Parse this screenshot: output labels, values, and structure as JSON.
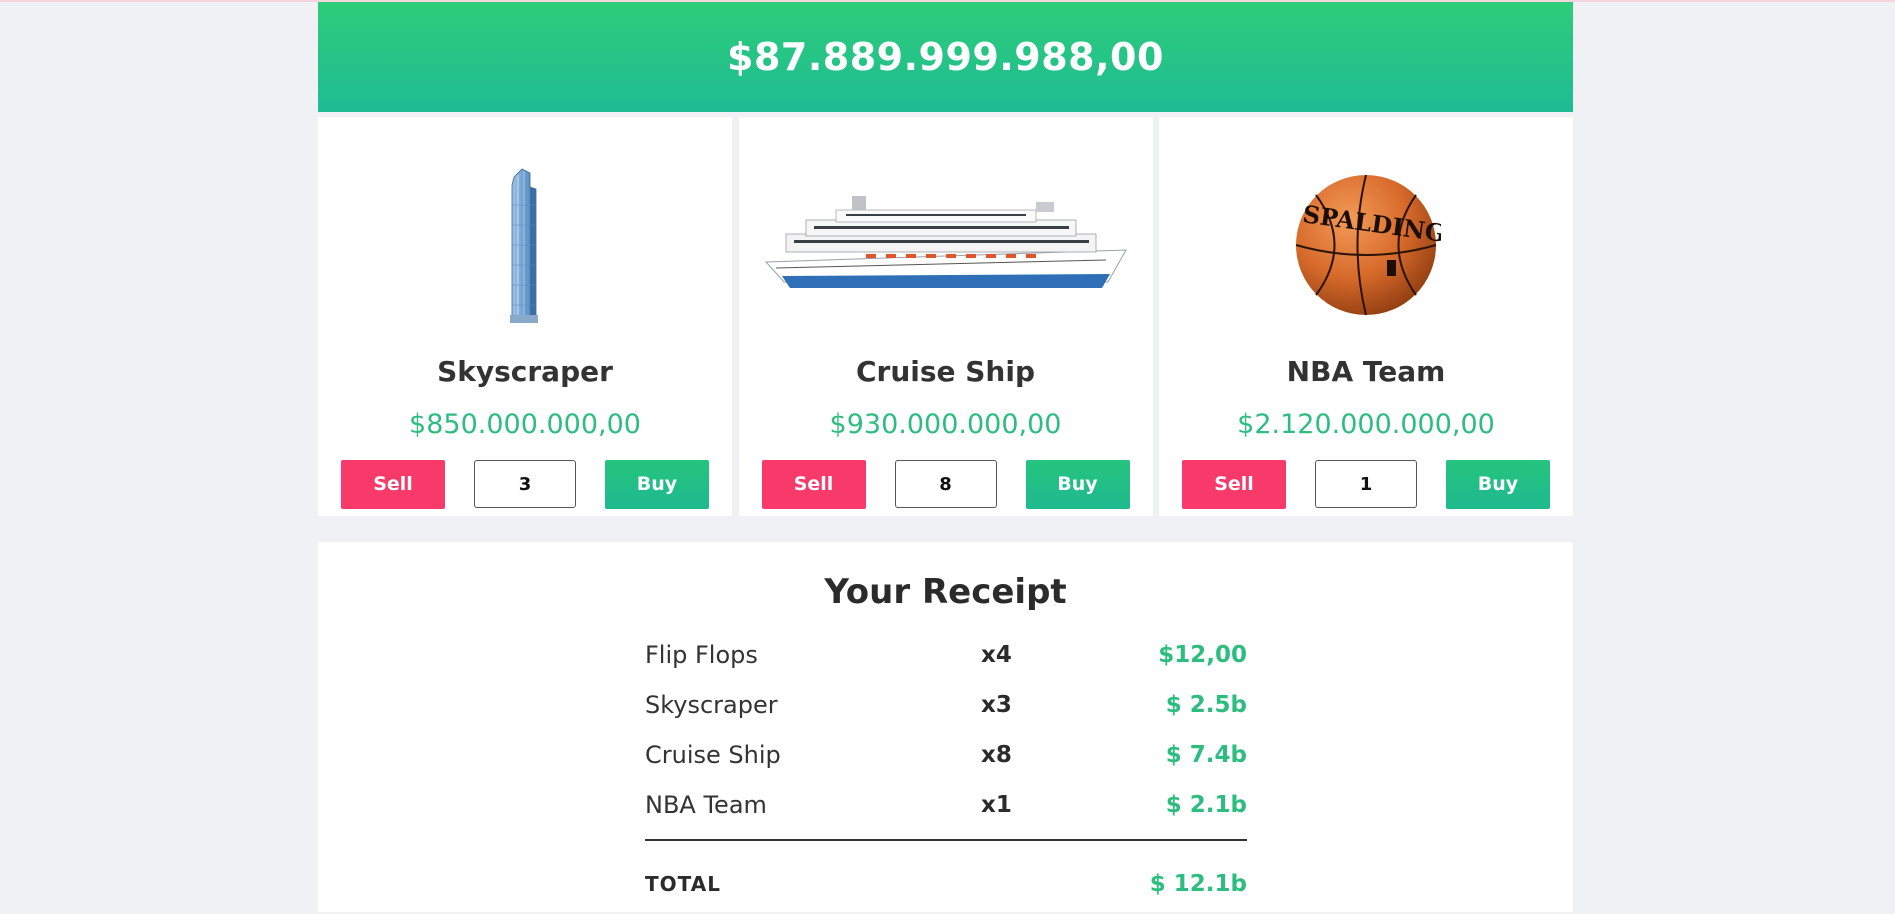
{
  "balance": "$87.889.999.988,00",
  "products": [
    {
      "name": "Skyscraper",
      "price": "$850.000.000,00",
      "quantity": "3",
      "sell_label": "Sell",
      "buy_label": "Buy",
      "icon": "skyscraper-image"
    },
    {
      "name": "Cruise Ship",
      "price": "$930.000.000,00",
      "quantity": "8",
      "sell_label": "Sell",
      "buy_label": "Buy",
      "icon": "cruise-ship-image"
    },
    {
      "name": "NBA Team",
      "price": "$2.120.000.000,00",
      "quantity": "1",
      "sell_label": "Sell",
      "buy_label": "Buy",
      "icon": "basketball-image",
      "ball_brand": "SPALDING"
    }
  ],
  "receipt": {
    "title": "Your Receipt",
    "items": [
      {
        "name": "Flip Flops",
        "qty": "x4",
        "amount": "$12,00"
      },
      {
        "name": "Skyscraper",
        "qty": "x3",
        "amount": "$ 2.5b"
      },
      {
        "name": "Cruise Ship",
        "qty": "x8",
        "amount": "$ 7.4b"
      },
      {
        "name": "NBA Team",
        "qty": "x1",
        "amount": "$ 2.1b"
      }
    ],
    "total_label": "TOTAL",
    "total_amount": "$ 12.1b"
  },
  "colors": {
    "accent_green": "#2dbd80",
    "sell_red": "#f83a6a",
    "header_green": "#2dcc78"
  }
}
